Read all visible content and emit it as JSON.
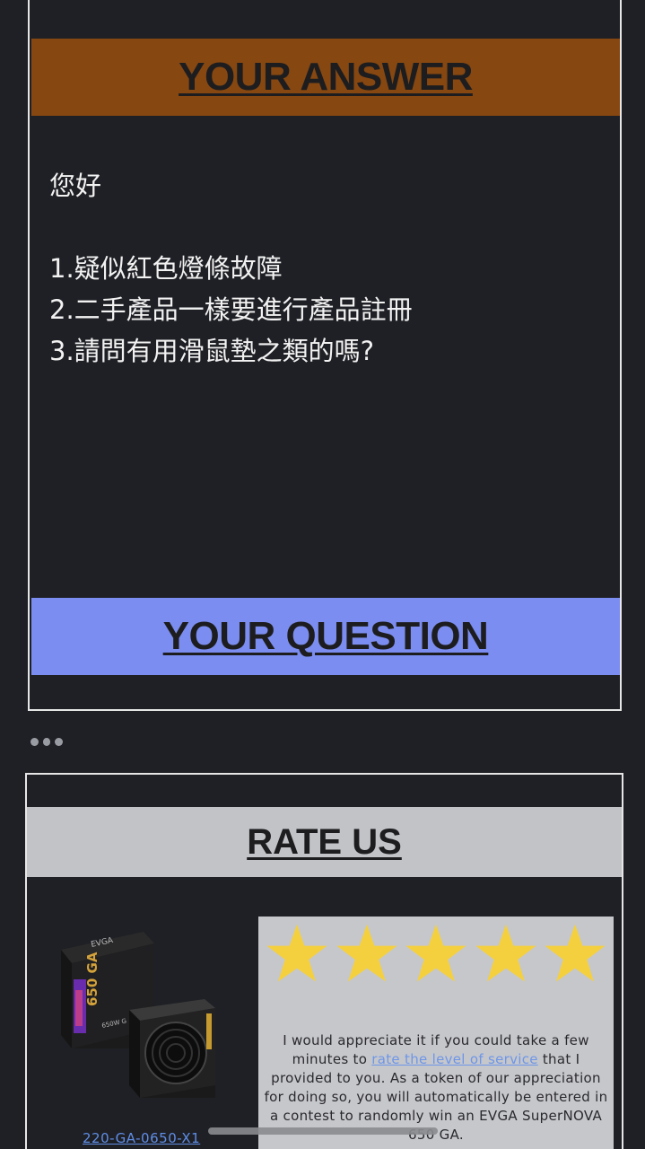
{
  "answer_section": {
    "title": "YOUR ANSWER",
    "greeting": "您好",
    "lines": [
      "1.疑似紅色燈條故障",
      "2.二手產品一樣要進行產品註冊",
      "3.請問有用滑鼠墊之類的嗎?"
    ]
  },
  "question_section": {
    "title": "YOUR QUESTION"
  },
  "more_label": "•••",
  "rate_section": {
    "title": "RATE US",
    "product_brand": "EVGA",
    "product_model_label": "650 GA",
    "product_wattage_label": "650W G",
    "product_link": "220-GA-0650-X1",
    "stars": 5,
    "text_before": "I would appreciate it if you could take a few minutes to ",
    "text_link": "rate the level of service",
    "text_after": " that I provided to you. As a token of our appreciation for doing so, you will automatically be entered in a contest to randomly win an EVGA SuperNOVA 650 GA."
  },
  "colors": {
    "background": "#1f2025",
    "answer_banner": "#864711",
    "question_banner": "#7b8df0",
    "rate_banner": "#c2c3c7",
    "star": "#f4d03f",
    "link": "#5f8de6"
  }
}
